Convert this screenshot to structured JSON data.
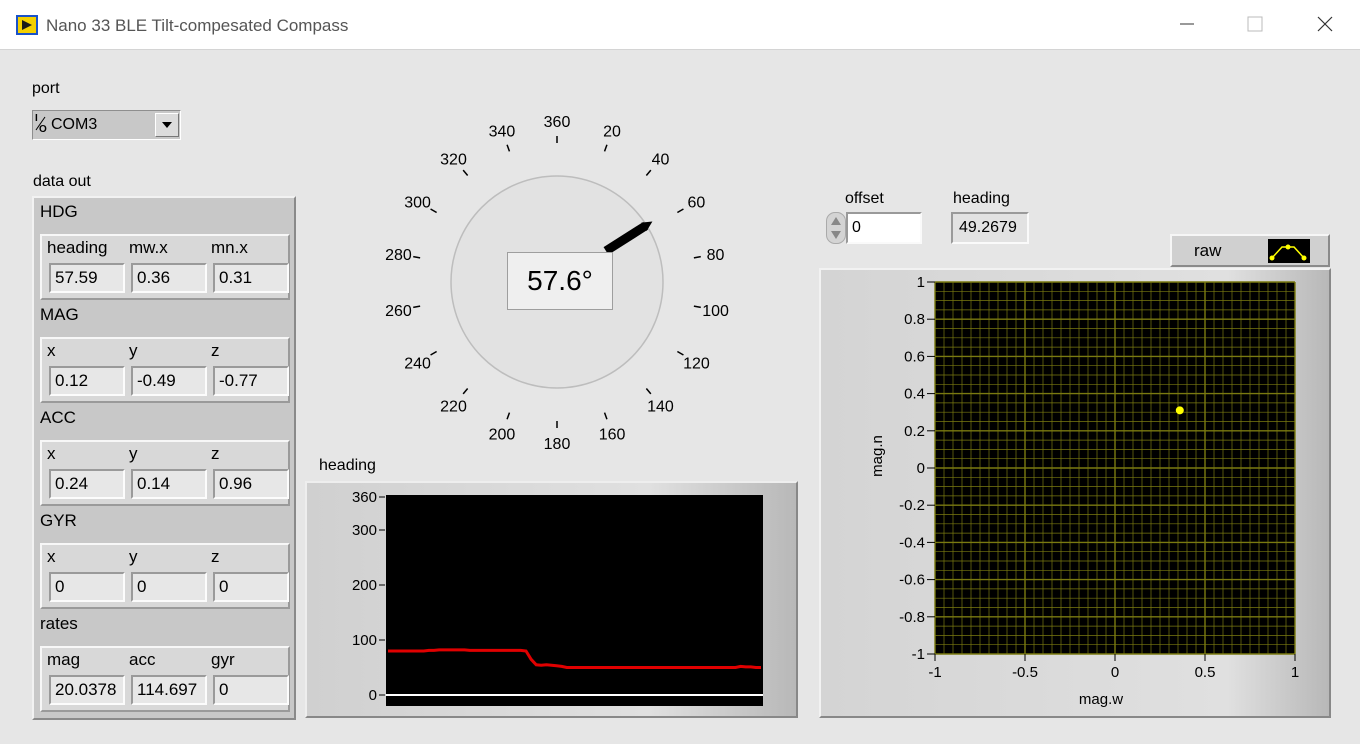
{
  "window": {
    "title": "Nano 33 BLE Tilt-compesated Compass"
  },
  "port": {
    "label": "port",
    "io_glyph": "I/O",
    "value": "COM3"
  },
  "data_out": {
    "label": "data out",
    "sections": [
      {
        "title": "HDG",
        "labels": [
          "heading",
          "mw.x",
          "mn.x"
        ],
        "values": [
          "57.59",
          "0.36",
          "0.31"
        ]
      },
      {
        "title": "MAG",
        "labels": [
          "x",
          "y",
          "z"
        ],
        "values": [
          "0.12",
          "-0.49",
          "-0.77"
        ]
      },
      {
        "title": "ACC",
        "labels": [
          "x",
          "y",
          "z"
        ],
        "values": [
          "0.24",
          "0.14",
          "0.96"
        ]
      },
      {
        "title": "GYR",
        "labels": [
          "x",
          "y",
          "z"
        ],
        "values": [
          "0",
          "0",
          "0"
        ]
      },
      {
        "title": "rates",
        "labels": [
          "mag",
          "acc",
          "gyr"
        ],
        "values": [
          "20.0378",
          "114.697",
          "0"
        ]
      }
    ]
  },
  "gauge": {
    "readout": "57.6°",
    "needle_value": 57.6,
    "tick_labels": [
      "20",
      "40",
      "60",
      "80",
      "100",
      "120",
      "140",
      "160",
      "180",
      "200",
      "220",
      "240",
      "260",
      "280",
      "300",
      "320",
      "340",
      "360"
    ]
  },
  "offset": {
    "label": "offset",
    "value": "0"
  },
  "heading_indicator": {
    "label": "heading",
    "value": "49.2679"
  },
  "legend": {
    "name": "raw"
  },
  "colors": {
    "trace_red": "#e00000",
    "xy_grid": "#7a7a10",
    "xy_point": "#ffff00",
    "plot_bg": "#000000"
  },
  "chart_data": [
    {
      "type": "line",
      "title": "heading",
      "xlabel": "",
      "ylabel": "",
      "ylim": [
        0,
        360
      ],
      "yticks": [
        "0",
        "100",
        "200",
        "300",
        "360"
      ],
      "series": [
        {
          "values": [
            80,
            80,
            80,
            80,
            80,
            80,
            80,
            80,
            81,
            81,
            82,
            82,
            82,
            82,
            82,
            82,
            81,
            81,
            81,
            81,
            81,
            81,
            81,
            81,
            81,
            81,
            81,
            80,
            65,
            55,
            54,
            55,
            54,
            53,
            52,
            50,
            50,
            50,
            50,
            50,
            50,
            50,
            50,
            50,
            50,
            50,
            50,
            50,
            50,
            50,
            50,
            50,
            50,
            50,
            50,
            50,
            50,
            50,
            50,
            50,
            50,
            50,
            50,
            50,
            50,
            50,
            50,
            50,
            50,
            52,
            51,
            51,
            50,
            50
          ]
        }
      ]
    },
    {
      "type": "scatter",
      "title": "",
      "xlabel": "mag.w",
      "ylabel": "mag.n",
      "xlim": [
        -1,
        1
      ],
      "ylim": [
        -1,
        1
      ],
      "xticks": [
        "-1",
        "-0.5",
        "0",
        "0.5",
        "1"
      ],
      "yticks": [
        "1",
        "0.8",
        "0.6",
        "0.4",
        "0.2",
        "0",
        "-0.2",
        "-0.4",
        "-0.6",
        "-0.8",
        "-1"
      ],
      "grid": true,
      "series": [
        {
          "name": "raw",
          "x": [
            0.36
          ],
          "y": [
            0.31
          ]
        }
      ]
    }
  ]
}
